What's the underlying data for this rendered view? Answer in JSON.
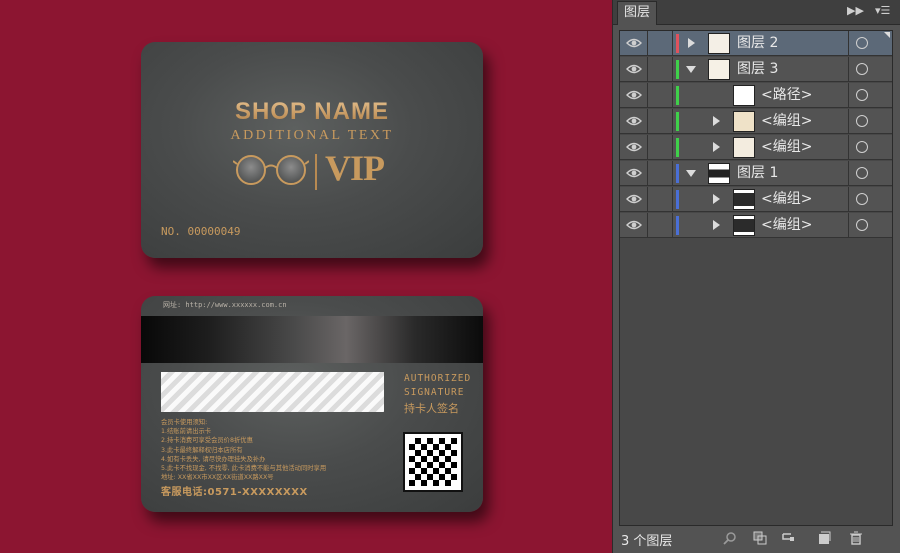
{
  "front_card": {
    "shop_name": "SHOP NAME",
    "additional_text": "ADDITIONAL TEXT",
    "vip": "VIP",
    "card_number": "NO. 00000049"
  },
  "back_card": {
    "website": "网址: http://www.xxxxxx.com.cn",
    "authorized_line1": "AUTHORIZED",
    "authorized_line2": "SIGNATURE",
    "holder_signature": "持卡人签名",
    "rules": [
      "会员卡使用须知:",
      "1.结账前请出示卡",
      "2.持卡消费可享受会员价8折优惠",
      "3.此卡最终解释权归本店所有",
      "4.如有卡丢失, 请尽快办理挂失及补办",
      "5.此卡不找现金, 不找零, 此卡消费不能与其他活动同时享用",
      "地址: XX省XX市XX区XX街道XX路XX号"
    ],
    "hotline": "客服电话:0571-XXXXXXXX"
  },
  "panel": {
    "tab_title": "图层",
    "footer_count": "3 个图层",
    "rows": [
      {
        "label": "图层 2",
        "indent": 0,
        "expander": "right",
        "color": "#e0525c",
        "selected": true
      },
      {
        "label": "图层 3",
        "indent": 0,
        "expander": "down",
        "color": "#3fd04a",
        "selected": false
      },
      {
        "label": "<路径>",
        "indent": 1,
        "expander": "none",
        "color": "#3fd04a",
        "selected": false
      },
      {
        "label": "<编组>",
        "indent": 1,
        "expander": "right",
        "color": "#3fd04a",
        "selected": false
      },
      {
        "label": "<编组>",
        "indent": 1,
        "expander": "right",
        "color": "#3fd04a",
        "selected": false
      },
      {
        "label": "图层 1",
        "indent": 0,
        "expander": "down",
        "color": "#4a6fd6",
        "selected": false
      },
      {
        "label": "<编组>",
        "indent": 1,
        "expander": "right",
        "color": "#4a6fd6",
        "selected": false
      },
      {
        "label": "<编组>",
        "indent": 1,
        "expander": "right",
        "color": "#4a6fd6",
        "selected": false
      }
    ]
  },
  "colors": {
    "background": "#8c1531",
    "gold": "#c89a5e",
    "card": "#4a4c4c",
    "panel": "#535353"
  }
}
